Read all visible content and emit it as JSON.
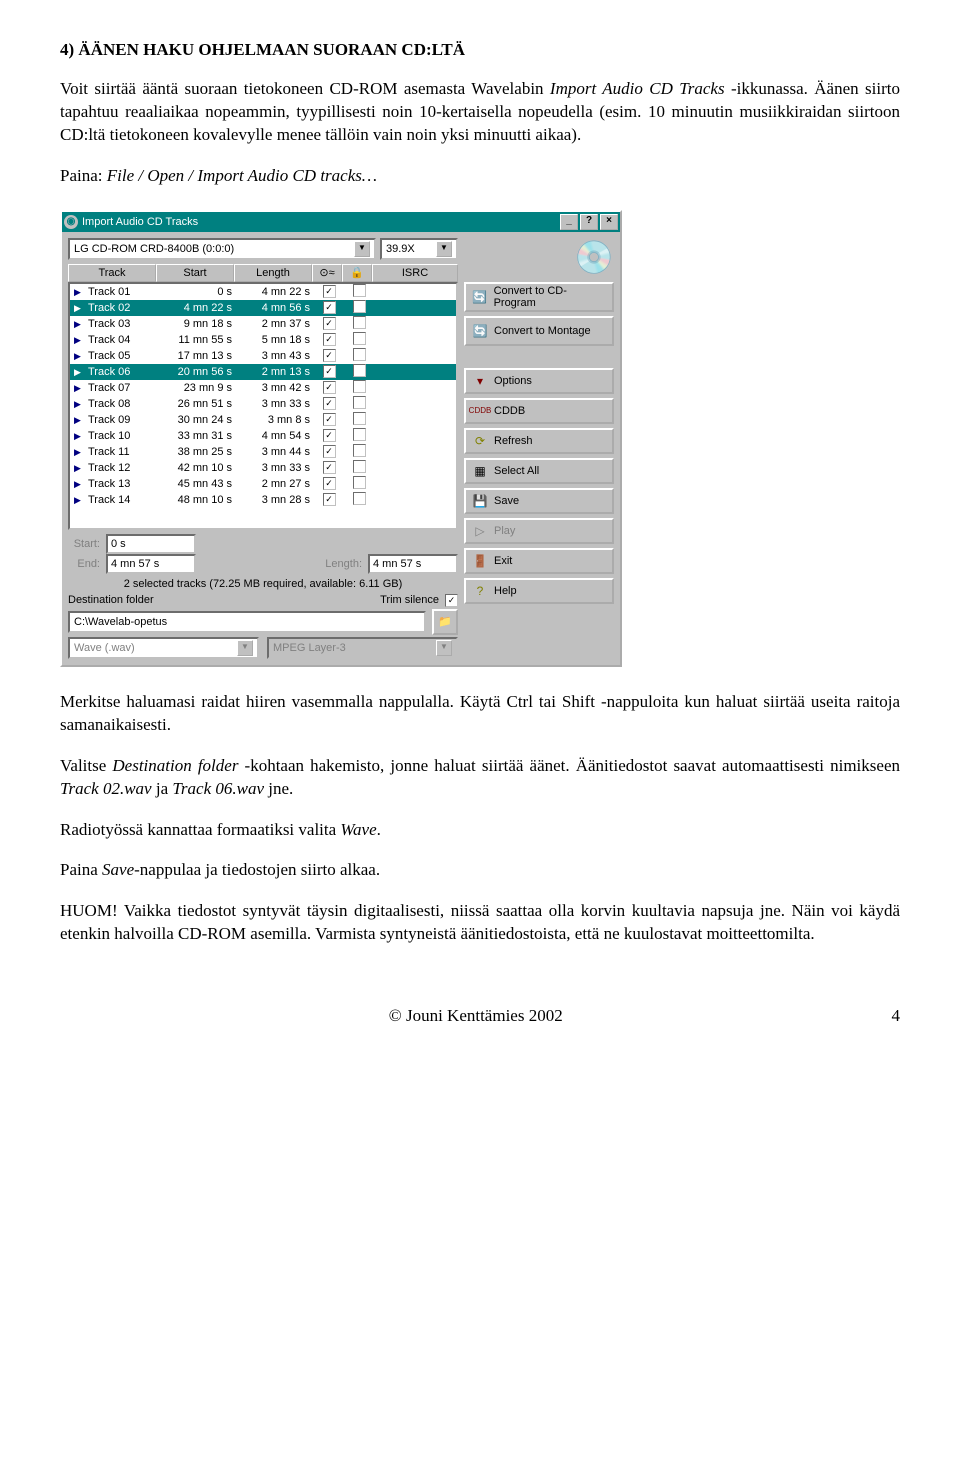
{
  "heading": "4) ÄÄNEN HAKU OHJELMAAN SUORAAN CD:LTÄ",
  "p1_a": "Voit siirtää ääntä suoraan tietokoneen CD-ROM asemasta Wavelabin ",
  "p1_b": "Import Audio CD Tracks",
  "p1_c": " -ikkunassa. Äänen siirto tapahtuu reaaliaikaa nopeammin, tyypillisesti noin 10-kertaisella nopeudella (esim. 10 minuutin musiikkiraidan siirtoon CD:ltä tietokoneen kovalevylle menee tällöin vain noin yksi minuutti aikaa).",
  "p2_a": "Paina: ",
  "p2_b": "File / Open / Import Audio CD tracks…",
  "win": {
    "title": "Import Audio CD Tracks",
    "drive": "LG      CD-ROM CRD-8400B (0:0:0)",
    "speed": "39.9X",
    "cols": {
      "track": "Track",
      "start": "Start",
      "length": "Length",
      "isrc": "ISRC"
    },
    "tracks": [
      {
        "n": "Track 01",
        "s": "0 s",
        "l": "4 mn 22 s",
        "c": true,
        "sel": false
      },
      {
        "n": "Track 02",
        "s": "4 mn 22 s",
        "l": "4 mn 56 s",
        "c": true,
        "sel": true
      },
      {
        "n": "Track 03",
        "s": "9 mn 18 s",
        "l": "2 mn 37 s",
        "c": true,
        "sel": false
      },
      {
        "n": "Track 04",
        "s": "11 mn 55 s",
        "l": "5 mn 18 s",
        "c": true,
        "sel": false
      },
      {
        "n": "Track 05",
        "s": "17 mn 13 s",
        "l": "3 mn 43 s",
        "c": true,
        "sel": false
      },
      {
        "n": "Track 06",
        "s": "20 mn 56 s",
        "l": "2 mn 13 s",
        "c": true,
        "sel": true
      },
      {
        "n": "Track 07",
        "s": "23 mn 9 s",
        "l": "3 mn 42 s",
        "c": true,
        "sel": false
      },
      {
        "n": "Track 08",
        "s": "26 mn 51 s",
        "l": "3 mn 33 s",
        "c": true,
        "sel": false
      },
      {
        "n": "Track 09",
        "s": "30 mn 24 s",
        "l": "3 mn 8 s",
        "c": true,
        "sel": false
      },
      {
        "n": "Track 10",
        "s": "33 mn 31 s",
        "l": "4 mn 54 s",
        "c": true,
        "sel": false
      },
      {
        "n": "Track 11",
        "s": "38 mn 25 s",
        "l": "3 mn 44 s",
        "c": true,
        "sel": false
      },
      {
        "n": "Track 12",
        "s": "42 mn 10 s",
        "l": "3 mn 33 s",
        "c": true,
        "sel": false
      },
      {
        "n": "Track 13",
        "s": "45 mn 43 s",
        "l": "2 mn 27 s",
        "c": true,
        "sel": false
      },
      {
        "n": "Track 14",
        "s": "48 mn 10 s",
        "l": "3 mn 28 s",
        "c": true,
        "sel": false
      }
    ],
    "btns": {
      "convprog": "Convert to CD-Program",
      "convmont": "Convert to Montage",
      "options": "Options",
      "cddb": "CDDB",
      "refresh": "Refresh",
      "selectall": "Select All",
      "save": "Save",
      "play": "Play",
      "exit": "Exit",
      "help": "Help"
    },
    "start_lbl": "Start:",
    "start_val": "0 s",
    "end_lbl": "End:",
    "end_val": "4 mn 57 s",
    "length_lbl": "Length:",
    "length_val": "4 mn 57 s",
    "status": "2 selected tracks (72.25 MB required, available: 6.11 GB)",
    "dest_lbl": "Destination folder",
    "trim_lbl": "Trim silence",
    "dest_val": "C:\\Wavelab-opetus",
    "fmt": "Wave (.wav)",
    "mpeg": "MPEG Layer-3"
  },
  "p3": "Merkitse haluamasi raidat hiiren vasemmalla nappulalla. Käytä Ctrl tai Shift -nappuloita kun haluat siirtää useita raitoja samanaikaisesti.",
  "p4_a": "Valitse ",
  "p4_b": "Destination folder",
  "p4_c": " -kohtaan hakemisto, jonne haluat siirtää äänet. Äänitiedostot saavat automaattisesti nimikseen ",
  "p4_d": "Track 02.wav",
  "p4_e": " ja ",
  "p4_f": "Track 06.wav",
  "p4_g": " jne.",
  "p5_a": "Radiotyössä kannattaa formaatiksi valita ",
  "p5_b": "Wave",
  "p5_c": ".",
  "p6_a": "Paina ",
  "p6_b": "Save",
  "p6_c": "-nappulaa ja tiedostojen siirto alkaa.",
  "p7": "HUOM! Vaikka tiedostot syntyvät täysin digitaalisesti, niissä saattaa olla korvin kuultavia napsuja jne. Näin voi käydä etenkin halvoilla CD-ROM asemilla. Varmista syntyneistä äänitiedostoista, että ne kuulostavat moitteettomilta.",
  "footer_l": "© Jouni Kenttämies 2002",
  "footer_r": "4"
}
